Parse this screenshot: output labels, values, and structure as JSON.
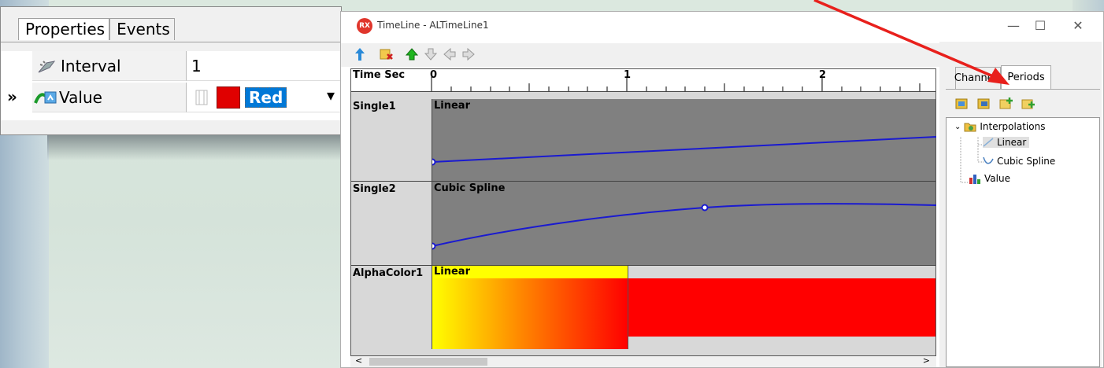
{
  "object_inspector": {
    "tabs": [
      "Properties",
      "Events"
    ],
    "rows": [
      {
        "name": "Interval",
        "value": "1"
      },
      {
        "name": "Value",
        "value_text": "Red",
        "swatch_color": "#e00000"
      }
    ],
    "expander_glyph": "»",
    "dropdown_glyph": "▾"
  },
  "timeline_window": {
    "title": "TimeLine - ALTimeLine1",
    "app_icon": "RX",
    "controls": {
      "minimize": "—",
      "maximize": "☐",
      "close": "✕"
    },
    "toolbar_icons": [
      "move-up-icon",
      "delete-icon",
      "green-up-arrow-icon",
      "down-arrow-icon",
      "left-arrow-icon",
      "right-arrow-icon"
    ],
    "ruler": {
      "label": "Time Sec",
      "ticks": [
        "0",
        "1",
        "2"
      ]
    },
    "lanes": [
      {
        "name": "Single1",
        "period": "Linear"
      },
      {
        "name": "Single2",
        "period": "Cubic Spline"
      },
      {
        "name": "AlphaColor1",
        "period": "Linear"
      }
    ],
    "scroll": {
      "left": "<",
      "right": ">"
    },
    "side_panel": {
      "tabs": [
        "Channels",
        "Periods"
      ],
      "active_tab": "Periods",
      "tree": {
        "root": "Interpolations",
        "children": [
          "Linear",
          "Cubic Spline"
        ],
        "sibling": "Value"
      }
    }
  },
  "colors": {
    "lane_bg": "#808080",
    "curve": "#1a1ad0",
    "gradient_start": "#ffff00",
    "gradient_end": "#ff0000",
    "annotation_arrow": "#e8201c"
  }
}
